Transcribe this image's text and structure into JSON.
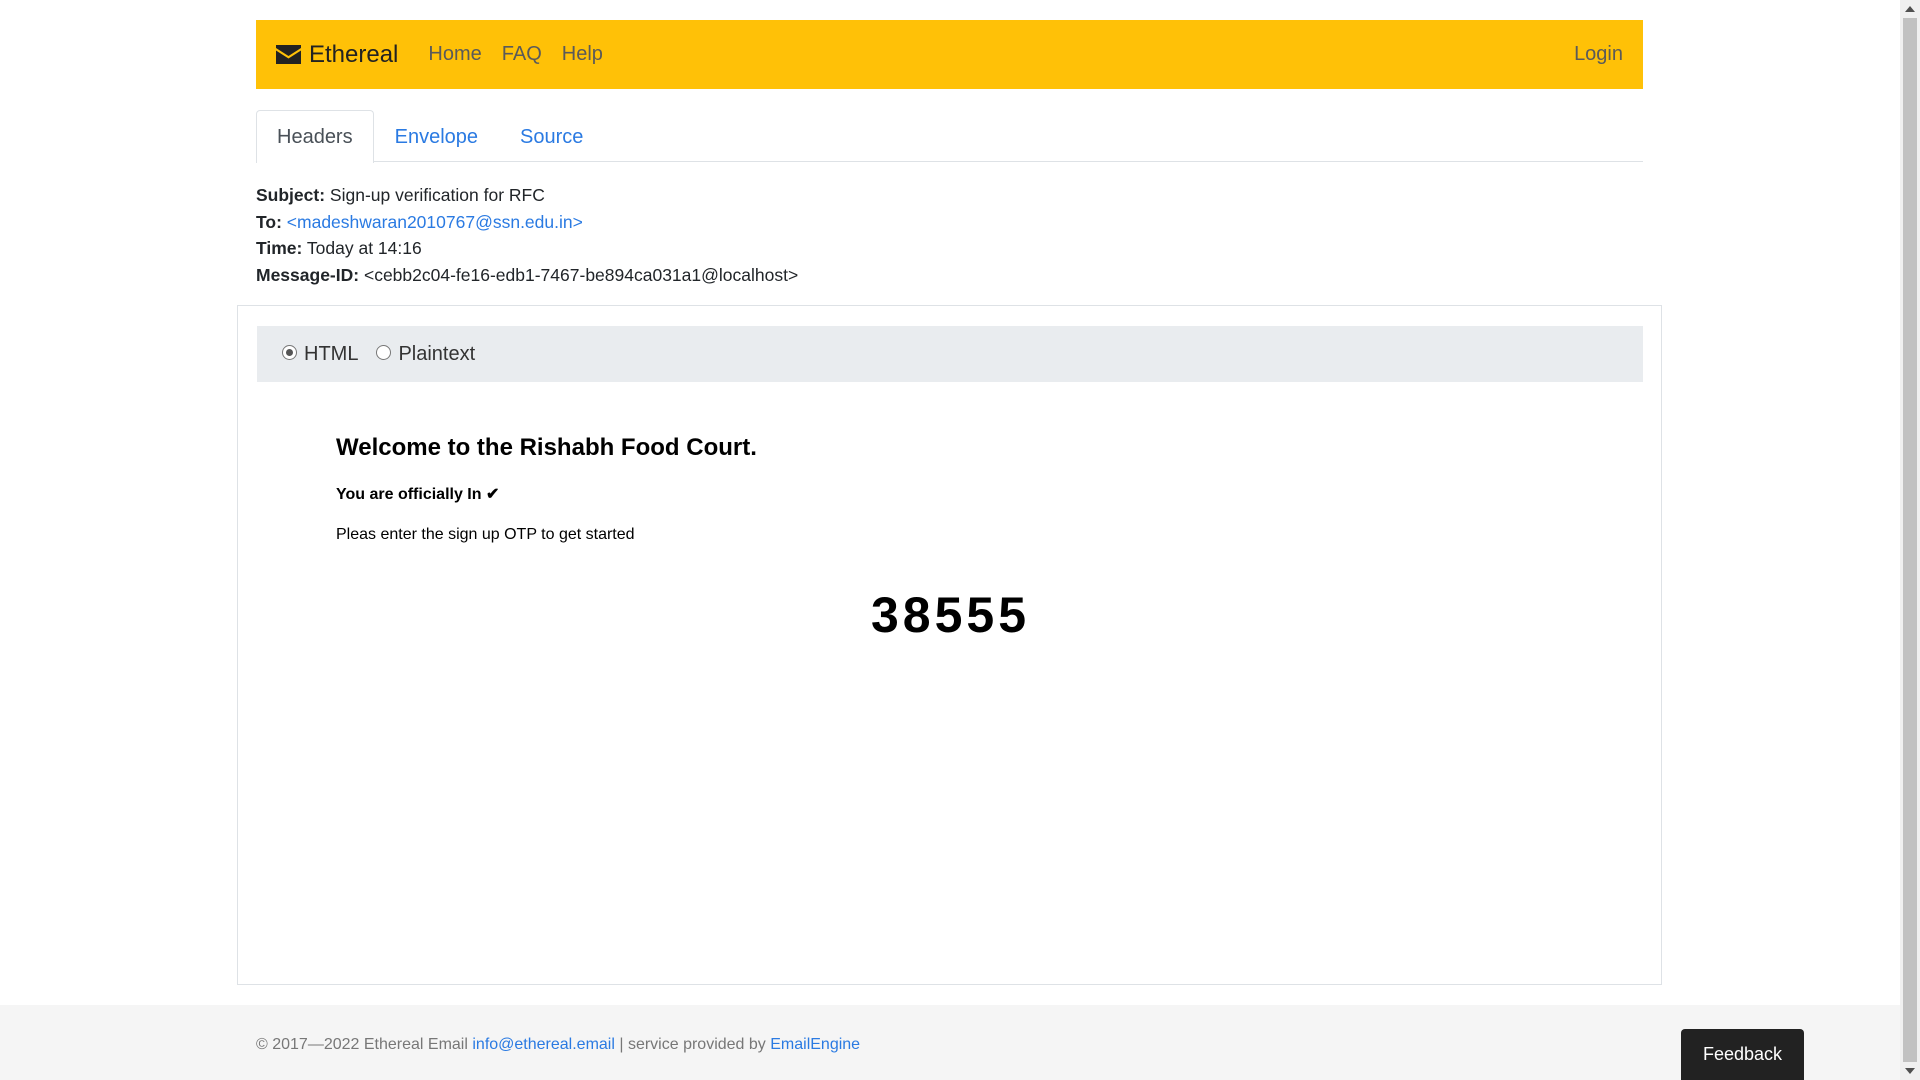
{
  "navbar": {
    "brand": "Ethereal",
    "brand_icon": "envelope-icon",
    "links": [
      "Home",
      "FAQ",
      "Help"
    ],
    "login": "Login",
    "color": "#ffc107"
  },
  "tabs": [
    "Headers",
    "Envelope",
    "Source"
  ],
  "headers": {
    "subject_label": "Subject:",
    "subject": "Sign-up verification for RFC",
    "to_label": "To:",
    "to": "<madeshwaran2010767@ssn.edu.in>",
    "time_label": "Time:",
    "time": "Today at 14:16",
    "message_id_label": "Message-ID:",
    "message_id": "<cebb2c04-fe16-edb1-7467-be894ca031a1@localhost>"
  },
  "view_options": {
    "html": "HTML",
    "plaintext": "Plaintext",
    "selected": "HTML"
  },
  "email": {
    "title": "Welcome to the Rishabh Food Court.",
    "subtitle": "You are officially In ✔",
    "text": "Pleas enter the sign up OTP to get started",
    "otp": "38555"
  },
  "footer": {
    "copyright": "© 2017—2022 Ethereal Email ",
    "email": "info@ethereal.email",
    "separator": " | service provided by ",
    "provider": "EmailEngine"
  },
  "feedback": "Feedback"
}
